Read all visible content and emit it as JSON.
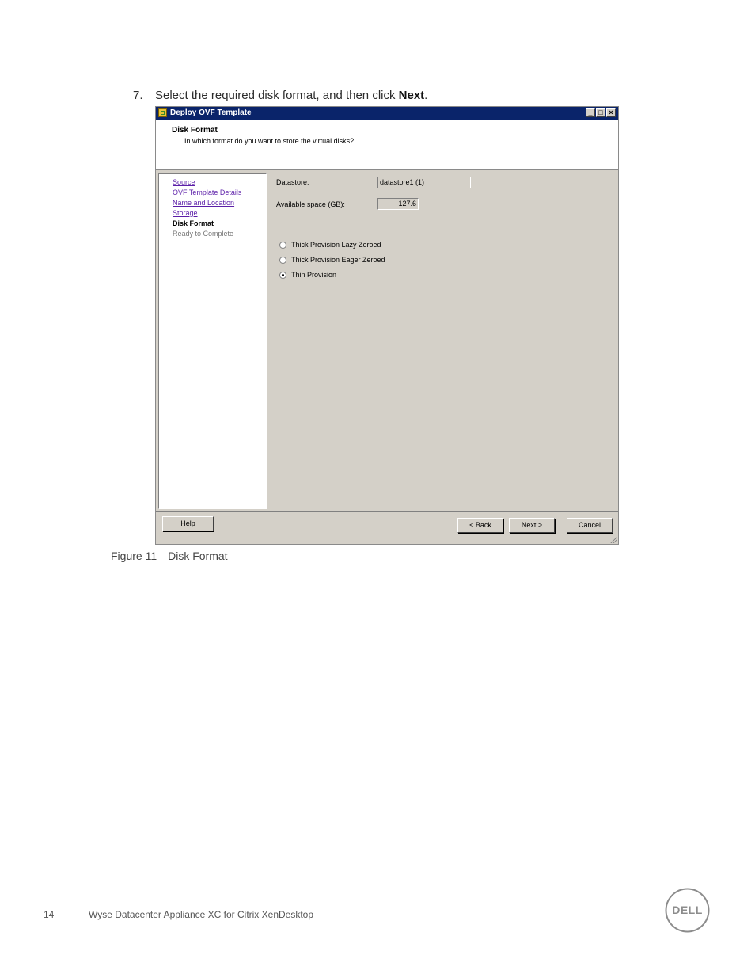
{
  "step": {
    "number": "7.",
    "text_before": "Select the required disk format, and then click ",
    "bold": "Next",
    "text_after": "."
  },
  "dialog": {
    "title": "Deploy OVF Template",
    "window_buttons": [
      "_",
      "□",
      "×"
    ],
    "header_title": "Disk Format",
    "header_subtitle": "In which format do you want to store the virtual disks?",
    "nav": [
      {
        "label": "Source",
        "state": "link"
      },
      {
        "label": "OVF Template Details",
        "state": "link"
      },
      {
        "label": "Name and Location",
        "state": "link"
      },
      {
        "label": "Storage",
        "state": "link"
      },
      {
        "label": "Disk Format",
        "state": "current"
      },
      {
        "label": "Ready to Complete",
        "state": "pending"
      }
    ],
    "datastore_label": "Datastore:",
    "datastore_value": "datastore1 (1)",
    "available_label": "Available space (GB):",
    "available_value": "127.6",
    "options": [
      {
        "label": "Thick Provision Lazy Zeroed",
        "checked": false
      },
      {
        "label": "Thick Provision Eager Zeroed",
        "checked": false
      },
      {
        "label": "Thin Provision",
        "checked": true
      }
    ],
    "buttons": {
      "help": "Help",
      "back": "< Back",
      "next": "Next >",
      "cancel": "Cancel"
    }
  },
  "caption": {
    "figure": "Figure 11",
    "text": "Disk Format"
  },
  "footer": {
    "page_number": "14",
    "doc_title": "Wyse Datacenter Appliance XC for Citrix XenDesktop",
    "logo_text": "DELL"
  },
  "colors": {
    "titlebar": "#0a246a",
    "dialog_bg": "#d4d0c8",
    "link": "#5b1ea8"
  }
}
